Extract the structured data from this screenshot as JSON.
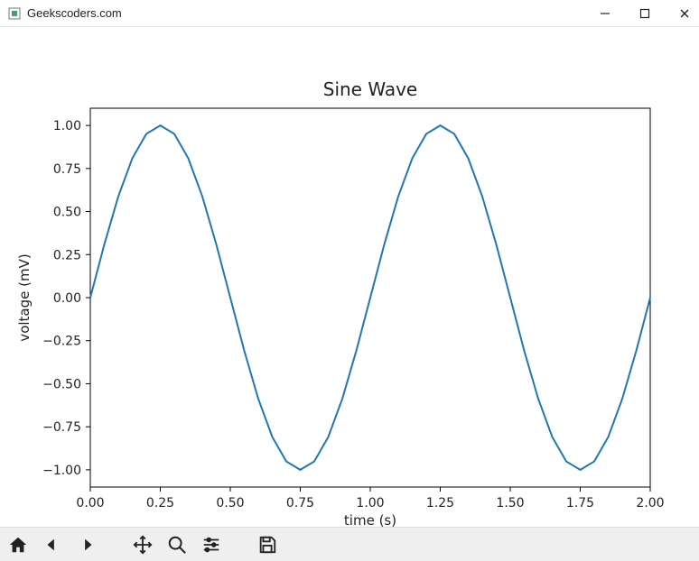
{
  "window": {
    "title": "Geekscoders.com"
  },
  "toolbar": {
    "home": "Home",
    "back": "Back",
    "forward": "Forward",
    "pan": "Pan",
    "zoom": "Zoom",
    "subplots": "Configure subplots",
    "save": "Save"
  },
  "chart_data": {
    "type": "line",
    "title": "Sine Wave",
    "xlabel": "time (s)",
    "ylabel": "voltage (mV)",
    "xlim": [
      0.0,
      2.0
    ],
    "ylim": [
      -1.0,
      1.0
    ],
    "xticks": [
      0.0,
      0.25,
      0.5,
      0.75,
      1.0,
      1.25,
      1.5,
      1.75,
      2.0
    ],
    "xtick_labels": [
      "0.00",
      "0.25",
      "0.50",
      "0.75",
      "1.00",
      "1.25",
      "1.50",
      "1.75",
      "2.00"
    ],
    "yticks": [
      -1.0,
      -0.75,
      -0.5,
      -0.25,
      0.0,
      0.25,
      0.5,
      0.75,
      1.0
    ],
    "ytick_labels": [
      "−1.00",
      "−0.75",
      "−0.50",
      "−0.25",
      "0.00",
      "0.25",
      "0.50",
      "0.75",
      "1.00"
    ],
    "series": [
      {
        "name": "voltage",
        "color": "#1f77b4",
        "x": [
          0.0,
          0.05,
          0.1,
          0.15,
          0.2,
          0.25,
          0.3,
          0.35,
          0.4,
          0.45,
          0.5,
          0.55,
          0.6,
          0.65,
          0.7,
          0.75,
          0.8,
          0.85,
          0.9,
          0.95,
          1.0,
          1.05,
          1.1,
          1.15,
          1.2,
          1.25,
          1.3,
          1.35,
          1.4,
          1.45,
          1.5,
          1.55,
          1.6,
          1.65,
          1.7,
          1.75,
          1.8,
          1.85,
          1.9,
          1.95,
          2.0
        ],
        "y": [
          0.0,
          0.309,
          0.588,
          0.809,
          0.951,
          1.0,
          0.951,
          0.809,
          0.588,
          0.309,
          0.0,
          -0.309,
          -0.588,
          -0.809,
          -0.951,
          -1.0,
          -0.951,
          -0.809,
          -0.588,
          -0.309,
          0.0,
          0.309,
          0.588,
          0.809,
          0.951,
          1.0,
          0.951,
          0.809,
          0.588,
          0.309,
          0.0,
          -0.309,
          -0.588,
          -0.809,
          -0.951,
          -1.0,
          -0.951,
          -0.809,
          -0.588,
          -0.309,
          0.0
        ]
      }
    ]
  }
}
